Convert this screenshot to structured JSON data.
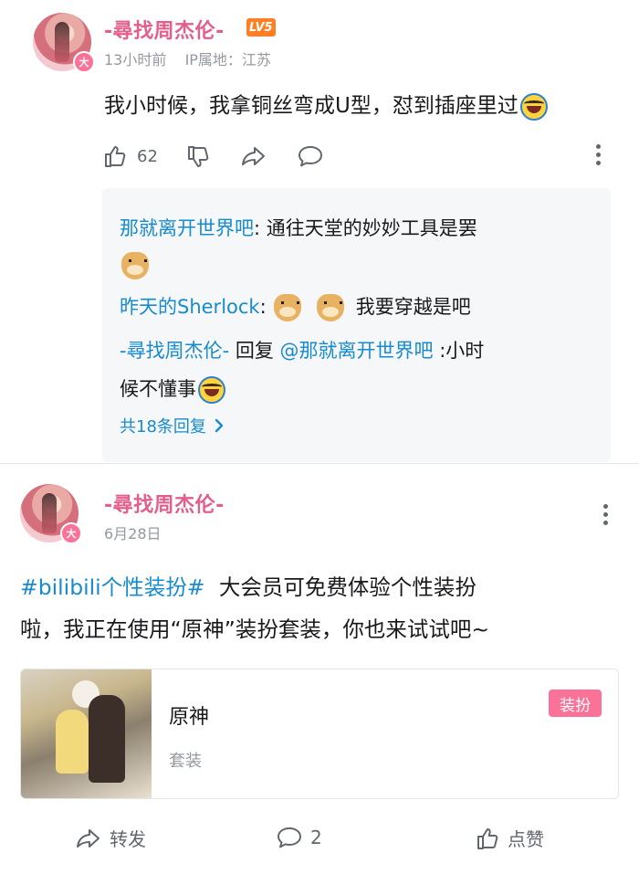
{
  "comment": {
    "username": "-尋找周杰伦-",
    "level": "LV5",
    "avatar_badge": "大",
    "time": "13小时前",
    "ip_location": "IP属地：江苏",
    "text": "我小时候，我拿铜丝弯成U型，怼到插座里过",
    "like_count": "62",
    "replies": [
      {
        "name": "那就离开世界吧",
        "text": "通往天堂的妙妙工具是罢"
      },
      {
        "name": "昨天的Sherlock",
        "text": "我要穿越是吧"
      },
      {
        "name": "-尋找周杰伦-",
        "reply_word": "回复",
        "mention": "@那就离开世界吧",
        "text_line1": ":小时",
        "text_line2": "候不懂事"
      }
    ],
    "more_replies": "共18条回复"
  },
  "post": {
    "username": "-尋找周杰伦-",
    "avatar_badge": "大",
    "date": "6月28日",
    "topic": "#bilibili个性装扮#",
    "text_line1": "大会员可免费体验个性装扮",
    "text_line2": "啦，我正在使用“原神”装扮套装，你也来试试吧~",
    "card": {
      "title": "原神",
      "subtitle": "套装",
      "tag": "装扮"
    },
    "footer": {
      "forward": "转发",
      "comment_count": "2",
      "like": "点赞"
    }
  },
  "colors": {
    "username_pink": "#e45e8c",
    "link_blue": "#178bcf",
    "level_orange": "#ff7f24",
    "tag_pink": "#fb7299"
  }
}
